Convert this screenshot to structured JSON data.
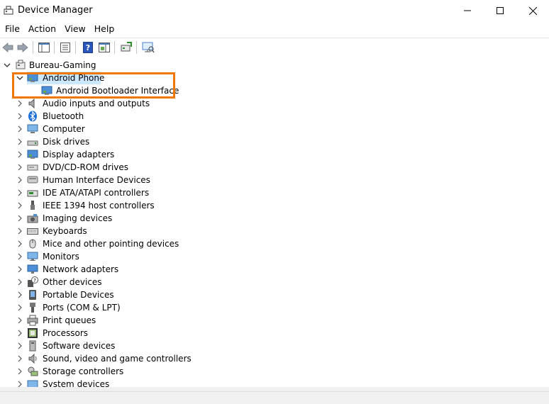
{
  "window": {
    "title": "Device Manager",
    "icon": "device-manager-icon",
    "controls": [
      "minimize",
      "maximize",
      "close"
    ]
  },
  "menu": {
    "items": [
      "File",
      "Action",
      "View",
      "Help"
    ]
  },
  "toolbar": {
    "buttons": [
      "back-icon",
      "forward-icon",
      "show-hide-console-tree-icon",
      "properties-icon",
      "help-icon",
      "show-action-pane-icon",
      "update-driver-icon",
      "scan-hardware-icon"
    ]
  },
  "tree": {
    "root": "Bureau-Gaming",
    "expanded_category": "Android Phone",
    "expanded_child": "Android Bootloader Interface",
    "categories": [
      "Audio inputs and outputs",
      "Bluetooth",
      "Computer",
      "Disk drives",
      "Display adapters",
      "DVD/CD-ROM drives",
      "Human Interface Devices",
      "IDE ATA/ATAPI controllers",
      "IEEE 1394 host controllers",
      "Imaging devices",
      "Keyboards",
      "Mice and other pointing devices",
      "Monitors",
      "Network adapters",
      "Other devices",
      "Portable Devices",
      "Ports (COM & LPT)",
      "Print queues",
      "Processors",
      "Software devices",
      "Sound, video and game controllers",
      "Storage controllers",
      "System devices"
    ]
  },
  "colors": {
    "highlight_box": "#f07800",
    "selection": "#cce8ff"
  }
}
